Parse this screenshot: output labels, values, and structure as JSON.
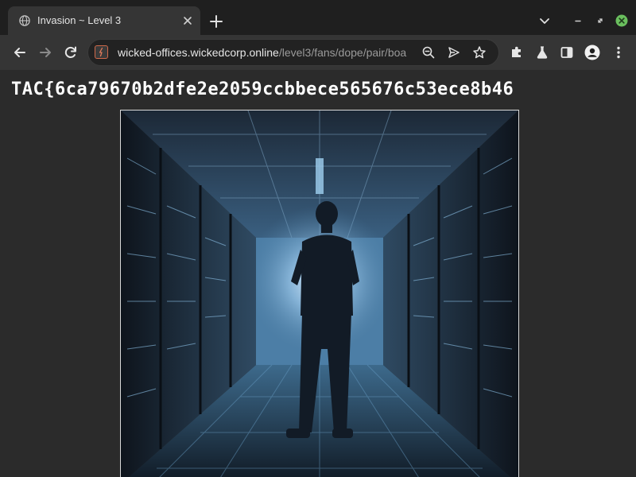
{
  "browser": {
    "tab": {
      "title": "Invasion ~ Level 3",
      "favicon": "globe-icon"
    },
    "new_tab": "plus-icon",
    "window_controls": [
      "chevron-down-icon",
      "minimize-icon",
      "maximize-icon",
      "close-icon"
    ],
    "close_color": "#6abf5e",
    "toolbar": {
      "back": "arrow-left-icon",
      "forward": "arrow-right-icon",
      "reload": "reload-icon",
      "url_host": "wicked-offices.wickedcorp.online",
      "url_path": "/level3/fans/dope/pair/boa",
      "omnibox_icons": [
        "zoom-icon",
        "send-icon",
        "star-icon"
      ],
      "extensions": [
        "puzzle-icon",
        "flask-icon",
        "sidepanel-icon",
        "profile-icon",
        "kebab-menu-icon"
      ]
    }
  },
  "page": {
    "flag": "TAC{6ca79670b2dfe2e2059ccbbece565676c53ece8b46",
    "image": "server-room-photo",
    "colors": {
      "background": "#2b2b2b",
      "flag_text": "#ffffff",
      "photo_border": "#d9d9d9"
    }
  }
}
